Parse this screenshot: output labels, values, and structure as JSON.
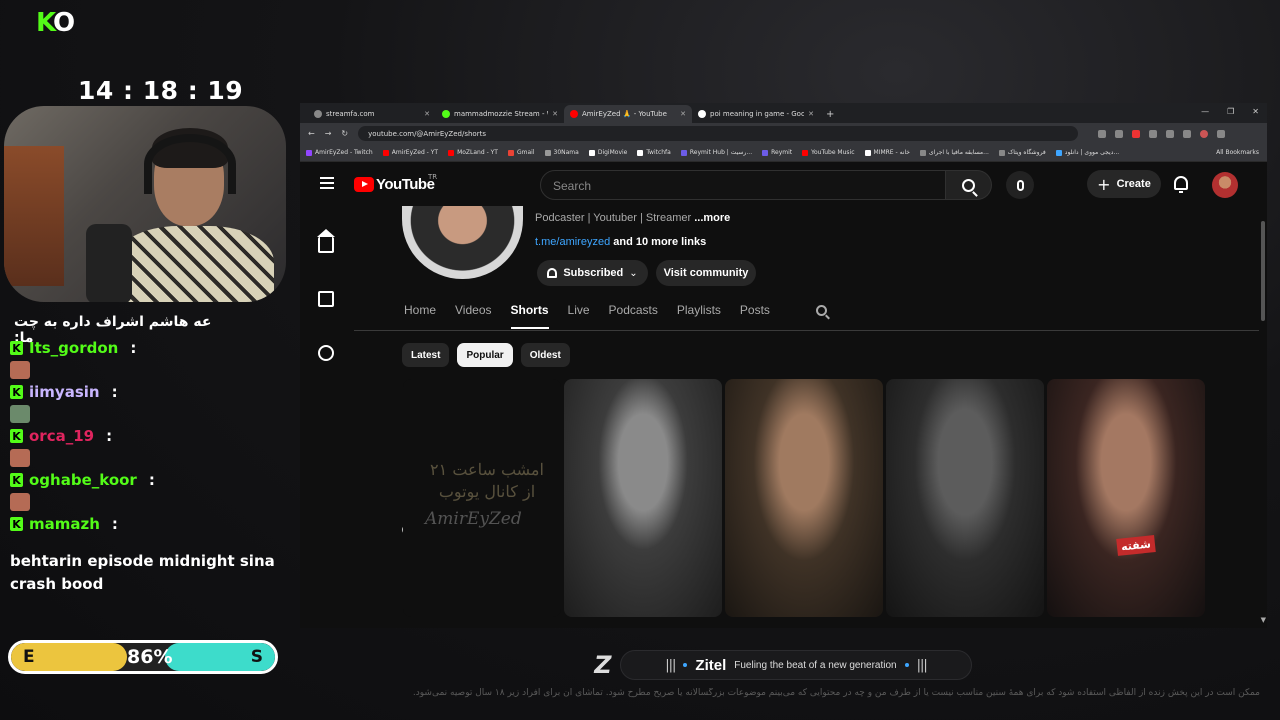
{
  "overlay": {
    "logo_k": "K",
    "logo_o": "O",
    "clock": "14 : 18 : 19",
    "chat_first": "عه هاشم اشراف داره به چت ما:",
    "chat": [
      {
        "user": "Its_gordon",
        "color": "#53fc18"
      },
      {
        "user": "iimyasin",
        "color": "#c9b6ff"
      },
      {
        "user": "orca_19",
        "color": "#e0245e"
      },
      {
        "user": "oghabe_koor",
        "color": "#53fc18"
      },
      {
        "user": "mamazh",
        "color": "#53fc18"
      }
    ],
    "badge_letter": "K",
    "colon": ":",
    "chat_last": "behtarin episode midnight sina crash bood",
    "meter": {
      "left": "E",
      "right": "S",
      "percent": "86%"
    }
  },
  "browser": {
    "tabs": [
      {
        "title": "streamfa.com",
        "fav": "#888888"
      },
      {
        "title": "mammadmozzie Stream - Wat...",
        "fav": "#53fc18"
      },
      {
        "title": "AmirEyZed 🙏 - YouTube",
        "fav": "#ff0000"
      },
      {
        "title": "poi meaning in game - Google...",
        "fav": "#ffffff"
      }
    ],
    "tab_close": "✕",
    "new_tab": "+",
    "window_controls": [
      "—",
      "❐",
      "✕"
    ],
    "url": "youtube.com/@AmirEyZed/shorts",
    "bookmarks": [
      {
        "label": "AmirEyZed - Twitch",
        "color": "#9146ff"
      },
      {
        "label": "AmirEyZed - YT",
        "color": "#ff0000"
      },
      {
        "label": "MoZLand - YT",
        "color": "#ff0000"
      },
      {
        "label": "Gmail",
        "color": "#ea4335"
      },
      {
        "label": "30Nama",
        "color": "#999999"
      },
      {
        "label": "DigiMovie",
        "color": "#ffffff"
      },
      {
        "label": "Twitchfa",
        "color": "#ffffff"
      },
      {
        "label": "Reymit Hub | رسیت...",
        "color": "#6c5ce7"
      },
      {
        "label": "Reymit",
        "color": "#6c5ce7"
      },
      {
        "label": "YouTube Music",
        "color": "#ff0000"
      },
      {
        "label": "MIMRE - خانه",
        "color": "#ffffff"
      },
      {
        "label": "مسابقه مافیا با اجرای...",
        "color": "#888888"
      },
      {
        "label": "فروشگاه ویتاک",
        "color": "#888888"
      },
      {
        "label": "دیجی مووی | دانلود...",
        "color": "#3ea6ff"
      }
    ],
    "all_bookmarks": "All Bookmarks"
  },
  "youtube": {
    "logo": "YouTube",
    "country": "TR",
    "search_placeholder": "Search",
    "create": "Create",
    "create_plus": "+",
    "channel_desc": "Podcaster | Youtuber | Streamer",
    "more": "...more",
    "link": "t.me/amireyzed",
    "more_links": "and 10 more links",
    "subscribed": "Subscribed",
    "subscribed_chevron": "⌄",
    "visit_community": "Visit community",
    "tabs": [
      "Home",
      "Videos",
      "Shorts",
      "Live",
      "Podcasts",
      "Playlists",
      "Posts"
    ],
    "active_tab": "Shorts",
    "chips": [
      "Latest",
      "Popular",
      "Oldest"
    ],
    "active_chip": "Popular",
    "short0_text": "امشب ساعت ۲۱ از کانال یوتوب",
    "short0_sig": "AmirEyZed",
    "short4_tag": "شفته",
    "scroll_arrow": "▼"
  },
  "sponsor": {
    "mark": "Z",
    "bars_left": "|||",
    "bars_right": "|||",
    "brand": "Zitel",
    "slogan": "Fueling the beat of a new generation"
  },
  "disclaimer": "ممکن است در این پخش زنده از الفاظی استفاده شود که برای همهٔ سنین مناسب نیست یا از طرف من و چه در محتوایی که می‌بینم موضوعات بزرگسالانه یا صریح مطرح شود. تماشای آن برای افراد زیر ۱۸ سال توصیه نمی‌شود."
}
